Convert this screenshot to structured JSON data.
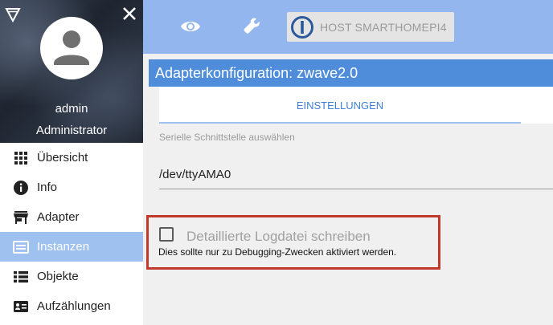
{
  "sidebar": {
    "user_name": "admin",
    "user_role": "Administrator",
    "items": [
      {
        "label": "Übersicht",
        "icon": "apps-grid-icon"
      },
      {
        "label": "Info",
        "icon": "info-icon"
      },
      {
        "label": "Adapter",
        "icon": "store-icon"
      },
      {
        "label": "Instanzen",
        "icon": "instances-icon",
        "active": true
      },
      {
        "label": "Objekte",
        "icon": "list-icon"
      },
      {
        "label": "Aufzählungen",
        "icon": "enum-icon"
      }
    ]
  },
  "topbar": {
    "host_label": "HOST SMARTHOMEPI4",
    "icons": [
      "eye-icon",
      "wrench-icon"
    ]
  },
  "main": {
    "title": "Adapterkonfiguration: zwave2.0",
    "tabs": [
      {
        "label": "EINSTELLUNGEN",
        "active": true
      }
    ],
    "serial": {
      "label": "Serielle Schnittstelle auswählen",
      "value": "/dev/ttyAMA0"
    },
    "debug_log": {
      "label": "Detaillierte Logdatei schreiben",
      "hint": "Dies sollte nur zu Debugging-Zwecken aktiviert werden.",
      "checked": false
    }
  },
  "colors": {
    "topbar": "#93b6ee",
    "title_bar": "#4f8ddb",
    "active_menu": "#9fc1ef",
    "tab_text": "#3f7ed3",
    "highlight_border": "#c0392b"
  }
}
